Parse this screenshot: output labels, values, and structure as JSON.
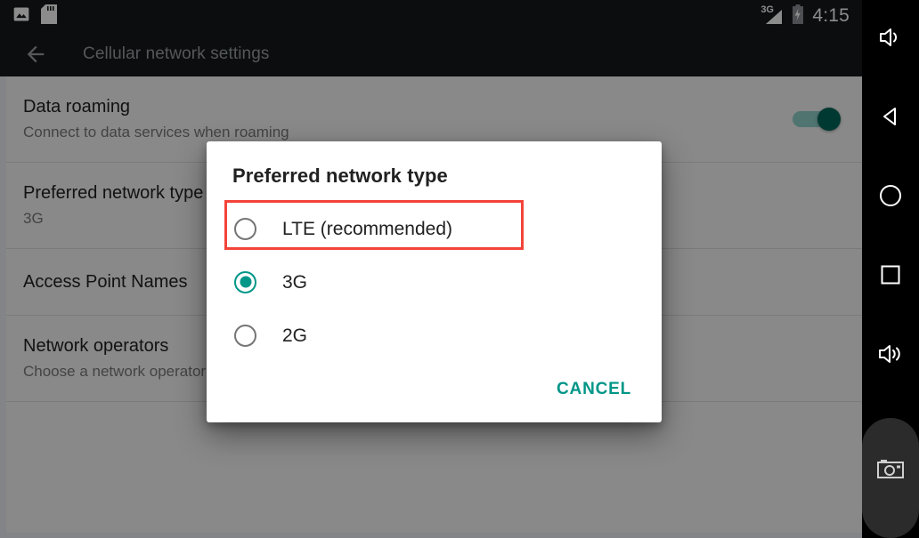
{
  "status_bar": {
    "left_icons": [
      {
        "name": "image-icon",
        "label": "Screenshot captured"
      },
      {
        "name": "sd-card-icon",
        "label": "SD card"
      }
    ],
    "signal_label": "3G",
    "signal_icon": "signal-triangle-icon",
    "battery_icon": "battery-charging-icon",
    "clock": "4:15"
  },
  "toolbar": {
    "back_icon": "back-arrow-icon",
    "title": "Cellular network settings"
  },
  "settings_list": [
    {
      "name": "data-roaming",
      "title": "Data roaming",
      "subtitle": "Connect to data services when roaming",
      "control": "switch",
      "switch_on": true
    },
    {
      "name": "preferred-network-type",
      "title": "Preferred network type",
      "subtitle": "3G",
      "control": "none"
    },
    {
      "name": "access-point-names",
      "title": "Access Point Names",
      "subtitle": "",
      "control": "none"
    },
    {
      "name": "network-operators",
      "title": "Network operators",
      "subtitle": "Choose a network operator",
      "control": "none"
    }
  ],
  "dialog": {
    "title": "Preferred network type",
    "options": [
      {
        "label": "LTE (recommended)",
        "selected": false,
        "highlighted": true
      },
      {
        "label": "3G",
        "selected": true,
        "highlighted": false
      },
      {
        "label": "2G",
        "selected": false,
        "highlighted": false
      }
    ],
    "cancel_label": "CANCEL"
  },
  "nav_bar": {
    "buttons": [
      {
        "name": "volume-up-icon",
        "label": "Volume up"
      },
      {
        "name": "back-triangle-icon",
        "label": "Back"
      },
      {
        "name": "home-circle-icon",
        "label": "Home"
      },
      {
        "name": "recents-square-icon",
        "label": "Recent apps"
      },
      {
        "name": "volume-down-icon",
        "label": "Volume down"
      },
      {
        "name": "camera-icon",
        "label": "Camera"
      }
    ]
  },
  "colors": {
    "accent_teal": "#009688",
    "highlight_red": "#f4433a",
    "status_bar_bg": "#14181b",
    "switch_thumb": "#00695c",
    "page_bg": "#fafafa"
  }
}
